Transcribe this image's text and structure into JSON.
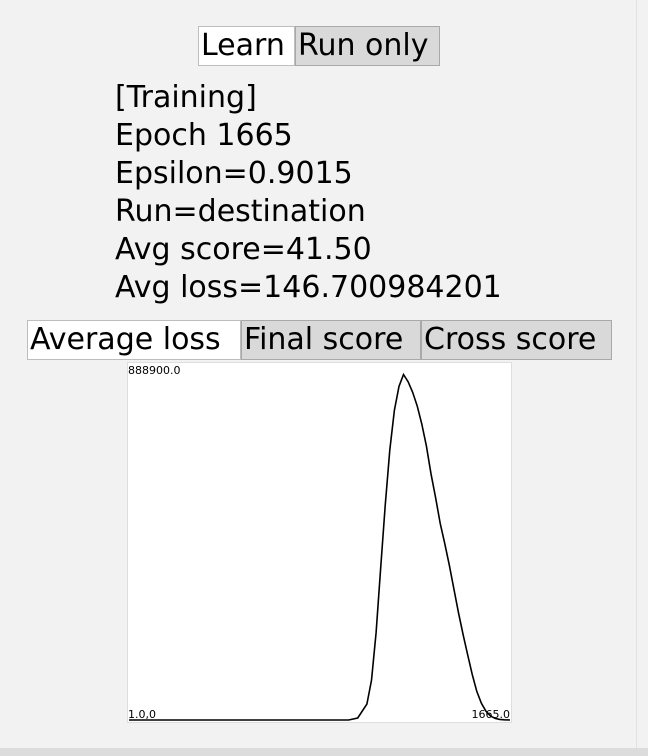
{
  "mode_buttons": {
    "learn": "Learn",
    "run_only": "Run only",
    "active": "learn"
  },
  "status": {
    "state": "[Training]",
    "epoch": "Epoch 1665",
    "epsilon": "Epsilon=0.9015",
    "run": "Run=destination",
    "avg_score": "Avg score=41.50",
    "avg_loss": "Avg loss=146.700984201"
  },
  "chart_tabs": {
    "average_loss": "Average loss",
    "final_score": "Final score",
    "cross_score": "Cross score",
    "active": "average_loss"
  },
  "chart_data": {
    "type": "line",
    "y_max_label": "888900.0",
    "x_min_label": "1.0,0",
    "x_max_label": "1665.0",
    "xlim": [
      1,
      1665
    ],
    "ylim": [
      0,
      888900
    ],
    "line_color": "#000000",
    "series": [
      {
        "x": [
          1,
          200,
          400,
          600,
          800,
          900,
          960,
          1000,
          1040,
          1060,
          1080,
          1100,
          1120,
          1140,
          1160,
          1180,
          1200,
          1220,
          1240,
          1260,
          1280,
          1300,
          1320,
          1340,
          1360,
          1380,
          1400,
          1420,
          1440,
          1460,
          1480,
          1500,
          1520,
          1540,
          1560,
          1580,
          1600,
          1620,
          1640,
          1665
        ],
        "y": [
          0,
          0,
          0,
          0,
          0,
          0,
          0,
          5000,
          40000,
          100000,
          220000,
          380000,
          540000,
          680000,
          780000,
          840000,
          870000,
          852000,
          825000,
          790000,
          745000,
          690000,
          620000,
          560000,
          495000,
          445000,
          390000,
          330000,
          270000,
          215000,
          165000,
          115000,
          72000,
          42000,
          22000,
          10000,
          4000,
          1500,
          500,
          0
        ]
      }
    ]
  }
}
